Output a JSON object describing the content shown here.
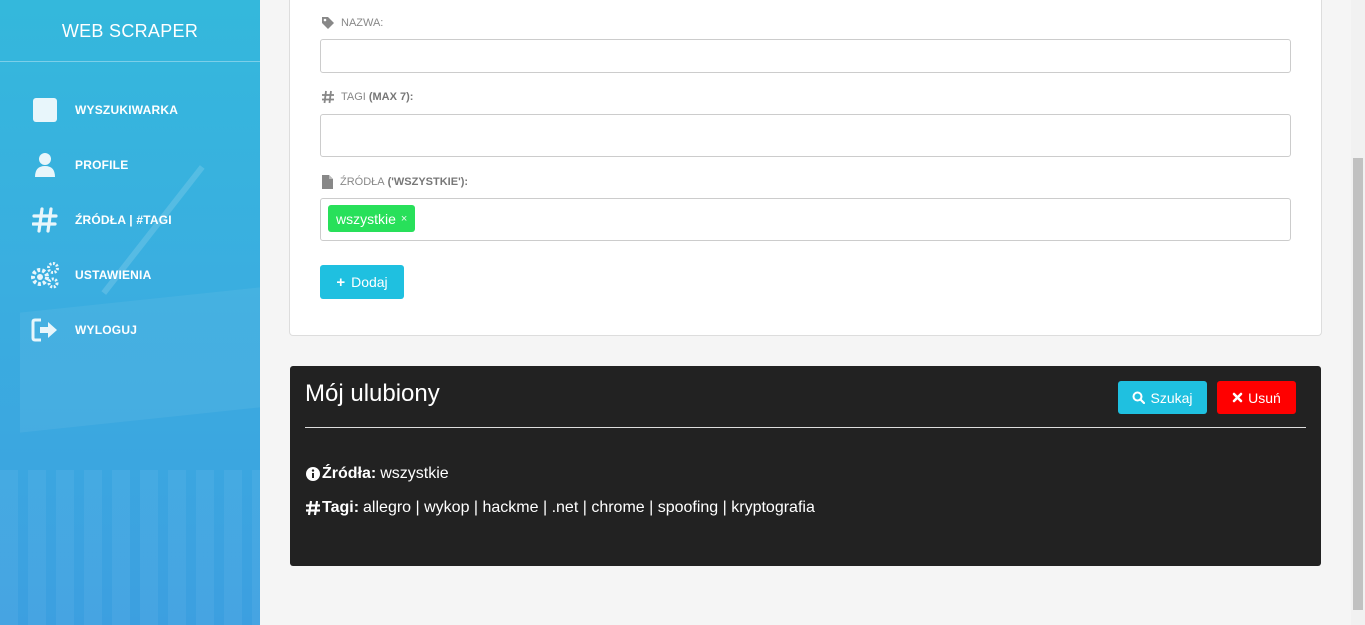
{
  "sidebar": {
    "brand": "WEB SCRAPER",
    "items": [
      {
        "label": "WYSZUKIWARKA",
        "icon": "search-square-icon"
      },
      {
        "label": "PROFILE",
        "icon": "user-icon"
      },
      {
        "label": "ŹRÓDŁA | #TAGI",
        "icon": "hashtag-icon"
      },
      {
        "label": "USTAWIENIA",
        "icon": "gears-icon"
      },
      {
        "label": "WYLOGUJ",
        "icon": "sign-out-icon"
      }
    ]
  },
  "form": {
    "name_label": "NAZWA:",
    "name_value": "",
    "tags_label": "TAGI",
    "tags_hint": "(MAX 7):",
    "tags_value": "",
    "sources_label": "ŹRÓDŁA",
    "sources_hint": "('WSZYSTKIE'):",
    "source_chip": "wszystkie",
    "source_chip_remove": "×",
    "add_button": "Dodaj"
  },
  "favorite": {
    "title": "Mój ulubiony",
    "search_button": "Szukaj",
    "delete_button": "Usuń",
    "sources_key": "Źródła:",
    "sources_value": "wszystkie",
    "tags_key": "Tagi:",
    "tags_value": "allegro | wykop | hackme | .net | chrome | spoofing | kryptografia"
  },
  "colors": {
    "accent": "#1fc0e0",
    "danger": "#ff0000",
    "chip": "#28e05a",
    "panel": "#222222",
    "sidebar": "#3aaee0"
  }
}
